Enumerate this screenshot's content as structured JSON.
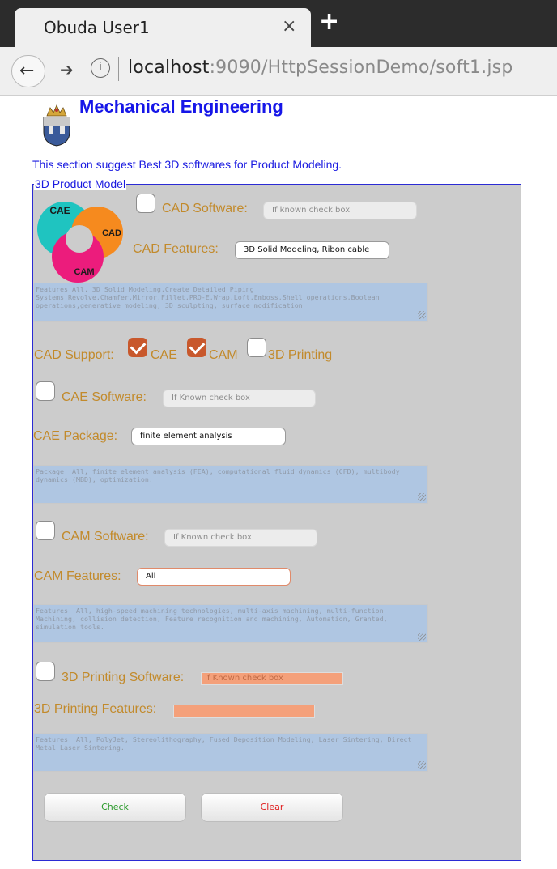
{
  "browser": {
    "tab_title": "Obuda User1",
    "tab_close": "×",
    "new_tab": "+",
    "back": "←",
    "forward": "➔",
    "info": "i",
    "url_host": "localhost",
    "url_rest": ":9090/HttpSessionDemo/soft1.jsp"
  },
  "page": {
    "heading": "Mechanical Engineering",
    "intro": "This section suggest Best 3D softwares for Product Modeling.",
    "legend": "3D Product Model"
  },
  "cad": {
    "software_label": "CAD Software:",
    "software_placeholder": "If known check box",
    "software_checked": false,
    "features_label": "CAD Features:",
    "features_value": "3D Solid Modeling, Ribon cable",
    "features_text": "Features:All, 3D Solid Modeling,Create Detailed Piping Systems,Revolve,Chamfer,Mirror,Fillet,PRO-E,Wrap,Loft,Emboss,Shell operations,Boolean operations,generative modeling, 3D sculpting, surface modification",
    "support_label": "CAD Support:",
    "support_options": [
      {
        "label": "CAE",
        "checked": true
      },
      {
        "label": "CAM",
        "checked": true
      },
      {
        "label": "3D Printing",
        "checked": false
      }
    ]
  },
  "cae": {
    "software_label": "CAE Software:",
    "software_placeholder": "If Known check box",
    "software_checked": false,
    "package_label": "CAE Package:",
    "package_value": "finite element analysis",
    "package_text": "Package: All, finite element analysis (FEA), computational fluid dynamics (CFD), multibody dynamics (MBD), optimization."
  },
  "cam": {
    "software_label": "CAM Software:",
    "software_placeholder": "If Known check box",
    "software_checked": false,
    "features_label": "CAM Features:",
    "features_value": "All",
    "features_text": "Features: All, high-speed machining technologies, multi-axis machining, multi-function Machining, collision detection, Feature recognition and machining, Automation, Granted, simulation tools."
  },
  "printing": {
    "software_label": "3D Printing Software:",
    "software_placeholder": "If Known check box",
    "software_checked": false,
    "features_label": "3D Printing Features:",
    "features_value": "",
    "features_text": "Features: All, PolyJet, Stereolithography, Fused Deposition Modeling, Laser Sintering, Direct Metal Laser Sintering."
  },
  "logo_badge": {
    "cae": "CAE",
    "cad": "CAD",
    "cam": "CAM"
  },
  "buttons": {
    "check": "Check",
    "clear": "Clear"
  },
  "colors": {
    "heading": "#1616e8",
    "label": "#c28a2b",
    "fieldset_bg": "#cccccc",
    "textarea_bg": "#afc6e2",
    "checkbox_checked": "#c8582c",
    "check_button_text": "#2a9a2a",
    "clear_button_text": "#e01c1c",
    "cae_circle": "#1fc4c0",
    "cad_circle": "#f68a1e",
    "cam_circle": "#ec1c7c"
  }
}
